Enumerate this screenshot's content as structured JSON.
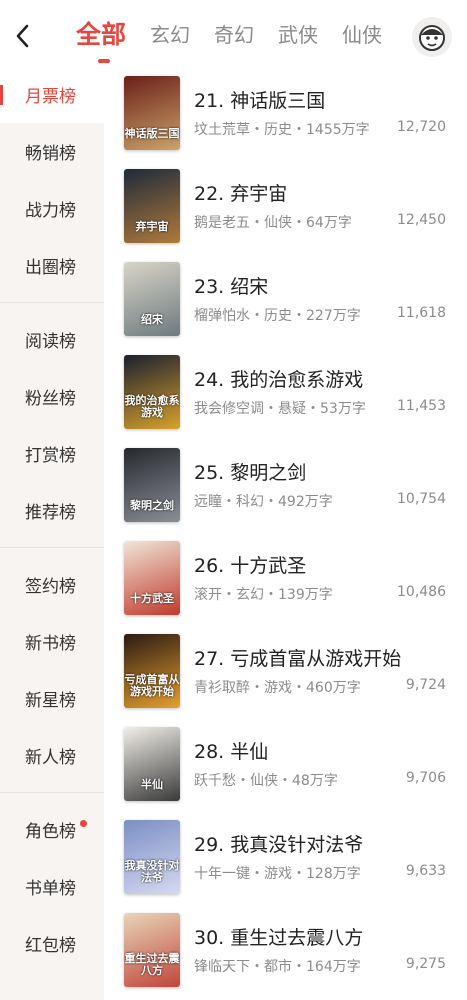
{
  "header": {
    "tabs": [
      {
        "label": "全部",
        "active": true
      },
      {
        "label": "玄幻",
        "active": false
      },
      {
        "label": "奇幻",
        "active": false
      },
      {
        "label": "武侠",
        "active": false
      },
      {
        "label": "仙侠",
        "active": false
      }
    ]
  },
  "sidebar": {
    "groups": [
      [
        {
          "label": "月票榜",
          "active": true
        },
        {
          "label": "畅销榜"
        },
        {
          "label": "战力榜"
        },
        {
          "label": "出圈榜"
        }
      ],
      [
        {
          "label": "阅读榜"
        },
        {
          "label": "粉丝榜"
        },
        {
          "label": "打赏榜"
        },
        {
          "label": "推荐榜"
        }
      ],
      [
        {
          "label": "签约榜"
        },
        {
          "label": "新书榜"
        },
        {
          "label": "新星榜"
        },
        {
          "label": "新人榜"
        }
      ],
      [
        {
          "label": "角色榜",
          "dot": true
        },
        {
          "label": "书单榜"
        },
        {
          "label": "红包榜"
        }
      ]
    ]
  },
  "books": [
    {
      "title": "21. 神话版三国",
      "meta": "坟土荒草・历史・1455万字",
      "count": "12,720",
      "cover_text": "神话版三国",
      "cover_colors": [
        "#6b1f1a",
        "#c9a46a"
      ]
    },
    {
      "title": "22. 弃宇宙",
      "meta": "鹅是老五・仙侠・64万字",
      "count": "12,450",
      "cover_text": "弃宇宙",
      "cover_colors": [
        "#1e2a3a",
        "#b07a3a"
      ]
    },
    {
      "title": "23. 绍宋",
      "meta": "榴弹怕水・历史・227万字",
      "count": "11,618",
      "cover_text": "绍宋",
      "cover_colors": [
        "#d9d4c8",
        "#6d7a7f"
      ]
    },
    {
      "title": "24. 我的治愈系游戏",
      "meta": "我会修空调・悬疑・53万字",
      "count": "11,453",
      "cover_text": "我的治愈系游戏",
      "cover_colors": [
        "#1b1f2e",
        "#d8a22c"
      ]
    },
    {
      "title": "25. 黎明之剑",
      "meta": "远瞳・科幻・492万字",
      "count": "10,754",
      "cover_text": "黎明之剑",
      "cover_colors": [
        "#26282c",
        "#8a8f96"
      ]
    },
    {
      "title": "26. 十方武圣",
      "meta": "滚开・玄幻・139万字",
      "count": "10,486",
      "cover_text": "十方武圣",
      "cover_colors": [
        "#efe6d8",
        "#c03a2b"
      ]
    },
    {
      "title": "27. 亏成首富从游戏开始",
      "meta": "青衫取醉・游戏・460万字",
      "count": "9,724",
      "cover_text": "亏成首富从游戏开始",
      "cover_colors": [
        "#2b1a12",
        "#e5a02f"
      ]
    },
    {
      "title": "28. 半仙",
      "meta": "跃千愁・仙侠・48万字",
      "count": "9,706",
      "cover_text": "半仙",
      "cover_colors": [
        "#f2efe9",
        "#3a3a3a"
      ]
    },
    {
      "title": "29. 我真没针对法爷",
      "meta": "十年一键・游戏・128万字",
      "count": "9,633",
      "cover_text": "我真没针对法爷",
      "cover_colors": [
        "#7b8fc4",
        "#d6d9ef"
      ]
    },
    {
      "title": "30. 重生过去震八方",
      "meta": "锋临天下・都市・164万字",
      "count": "9,275",
      "cover_text": "重生过去震八方",
      "cover_colors": [
        "#e8d6b8",
        "#c0453a"
      ]
    }
  ]
}
